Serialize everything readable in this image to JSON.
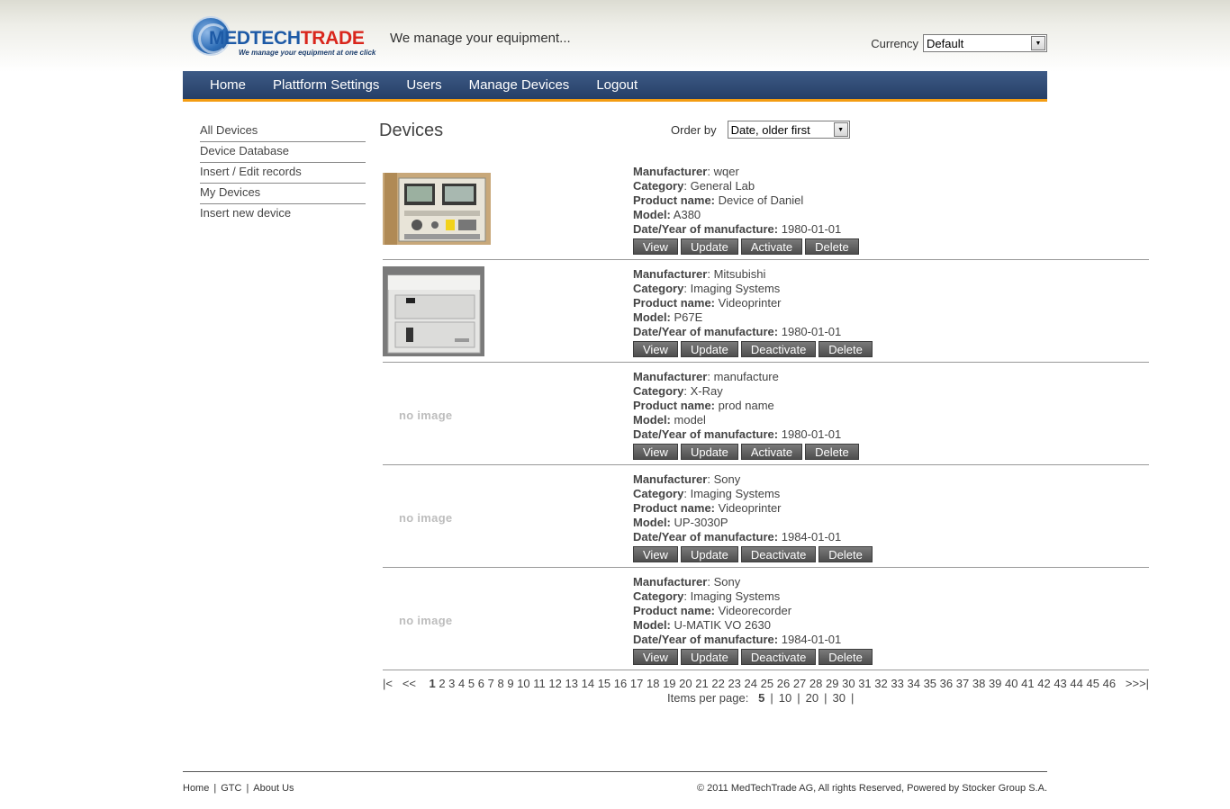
{
  "header": {
    "logo_brand_1": "MEDTECH",
    "logo_brand_2": "TRADE",
    "logo_tagline": "We manage your equipment at one click",
    "slogan": "We manage your equipment...",
    "currency_label": "Currency",
    "currency_value": "Default"
  },
  "nav": {
    "items": [
      {
        "label": "Home"
      },
      {
        "label": "Plattform Settings"
      },
      {
        "label": "Users"
      },
      {
        "label": "Manage Devices"
      },
      {
        "label": "Logout"
      }
    ]
  },
  "sidebar": {
    "items": [
      {
        "label": "All Devices"
      },
      {
        "label": "Device Database"
      },
      {
        "label": "Insert / Edit records"
      },
      {
        "label": "My Devices"
      },
      {
        "label": "Insert new device"
      }
    ]
  },
  "main": {
    "title": "Devices",
    "order_label": "Order by",
    "order_value": "Date, older first"
  },
  "field_labels": {
    "manufacturer": "Manufacturer",
    "category": "Category",
    "product_name": "Product name:",
    "model": "Model:",
    "date": "Date/Year of manufacture:"
  },
  "buttons": {
    "view": "View",
    "update": "Update",
    "delete": "Delete"
  },
  "no_image_text": "no image",
  "devices": [
    {
      "manufacturer": "wqer",
      "category": "General Lab",
      "product_name": "Device of Daniel",
      "model": "A380",
      "date": "1980-01-01",
      "toggle": "Activate",
      "image": "thumb-lab"
    },
    {
      "manufacturer": "Mitsubishi",
      "category": "Imaging Systems",
      "product_name": "Videoprinter",
      "model": "P67E",
      "date": "1980-01-01",
      "toggle": "Deactivate",
      "image": "thumb-printer"
    },
    {
      "manufacturer": "manufacture",
      "category": "X-Ray",
      "product_name": "prod name",
      "model": "model",
      "date": "1980-01-01",
      "toggle": "Activate",
      "image": "none"
    },
    {
      "manufacturer": "Sony",
      "category": "Imaging Systems",
      "product_name": "Videoprinter",
      "model": "UP-3030P",
      "date": "1984-01-01",
      "toggle": "Deactivate",
      "image": "none"
    },
    {
      "manufacturer": "Sony",
      "category": "Imaging Systems",
      "product_name": "Videorecorder",
      "model": "U-MATIK VO 2630",
      "date": "1984-01-01",
      "toggle": "Deactivate",
      "image": "none"
    }
  ],
  "pager": {
    "first": "|<",
    "prev": "<<",
    "next": ">>",
    "last": ">|",
    "current": "1",
    "pages": [
      "1",
      "2",
      "3",
      "4",
      "5",
      "6",
      "7",
      "8",
      "9",
      "10",
      "11",
      "12",
      "13",
      "14",
      "15",
      "16",
      "17",
      "18",
      "19",
      "20",
      "21",
      "22",
      "23",
      "24",
      "25",
      "26",
      "27",
      "28",
      "29",
      "30",
      "31",
      "32",
      "33",
      "34",
      "35",
      "36",
      "37",
      "38",
      "39",
      "40",
      "41",
      "42",
      "43",
      "44",
      "45",
      "46"
    ],
    "items_per_page_label": "Items per page:",
    "items_per_page_options": [
      "5",
      "10",
      "20",
      "30"
    ]
  },
  "footer": {
    "links": [
      "Home",
      "GTC",
      "About Us"
    ],
    "copyright": "© 2011 MedTechTrade AG, All rights Reserved, Powered by Stocker Group S.A."
  }
}
